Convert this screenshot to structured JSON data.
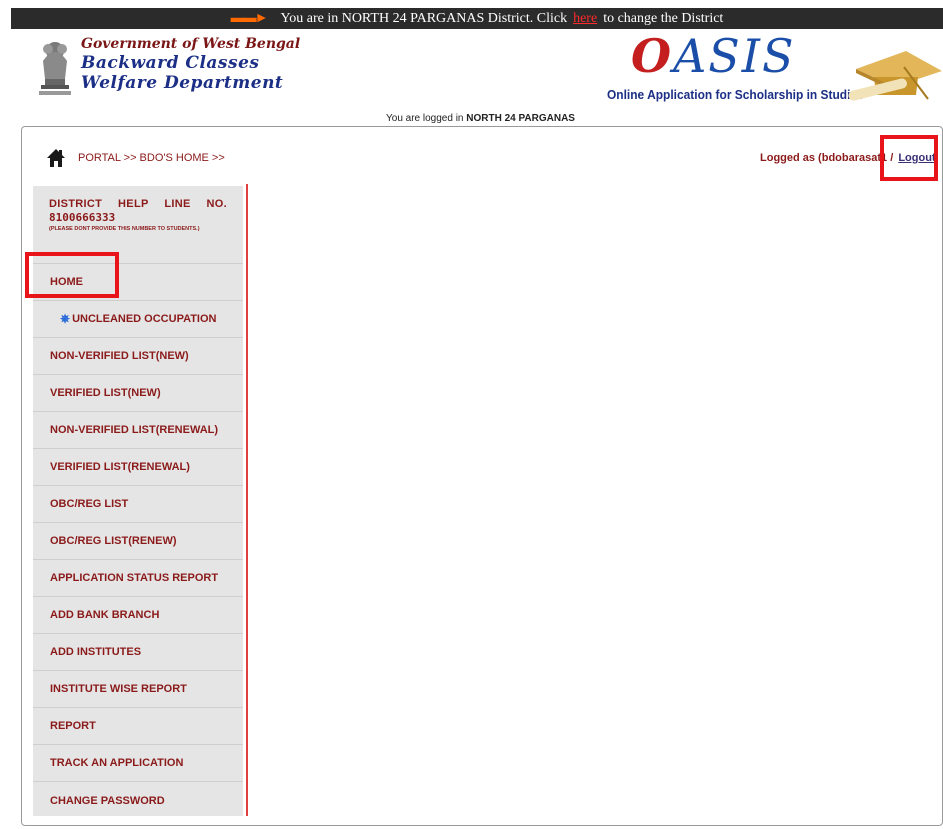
{
  "topbar": {
    "text_before": "You are in NORTH 24 PARGANAS District. Click",
    "link": "here",
    "text_after": "to change the District"
  },
  "header": {
    "gov_line1": "Government of West Bengal",
    "gov_line2": "Backward Classes",
    "gov_line3": "Welfare Department",
    "logo_text": "ASIS",
    "logo_first_letter": "O",
    "logo_subtitle": "Online Application for Scholarship in Studies"
  },
  "session": {
    "logged_in_prefix": "You are logged in",
    "logged_in_district": "NORTH 24 PARGANAS",
    "logged_as": "Logged as (bdobarasat1",
    "logout": "Logout"
  },
  "breadcrumb": "PORTAL >> BDO'S HOME >>",
  "helpline": {
    "title": "DISTRICT HELP LINE NO.",
    "number": "8100666333",
    "note": "(PLEASE DONT PROVIDE THIS NUMBER TO STUDENTS.)"
  },
  "nav": [
    "HOME",
    "UNCLEANED OCCUPATION",
    "NON-VERIFIED LIST(NEW)",
    "VERIFIED LIST(NEW)",
    "NON-VERIFIED LIST(RENEWAL)",
    "VERIFIED LIST(RENEWAL)",
    "OBC/REG LIST",
    "OBC/REG LIST(RENEW)",
    "APPLICATION STATUS REPORT",
    "ADD BANK BRANCH",
    "ADD INSTITUTES",
    "INSTITUTE WISE REPORT",
    "REPORT",
    "TRACK AN APPLICATION",
    "CHANGE PASSWORD"
  ],
  "icons": {
    "arrow": "arrow-right-icon",
    "home": "home-icon",
    "new": "star-burst-icon",
    "emblem": "state-emblem-icon",
    "cap": "graduation-cap-icon"
  },
  "colors": {
    "accent": "#8b1a1a",
    "highlight": "#e8141a",
    "nav_bg": "#e5e5e5",
    "brand_blue": "#1c2f86"
  }
}
